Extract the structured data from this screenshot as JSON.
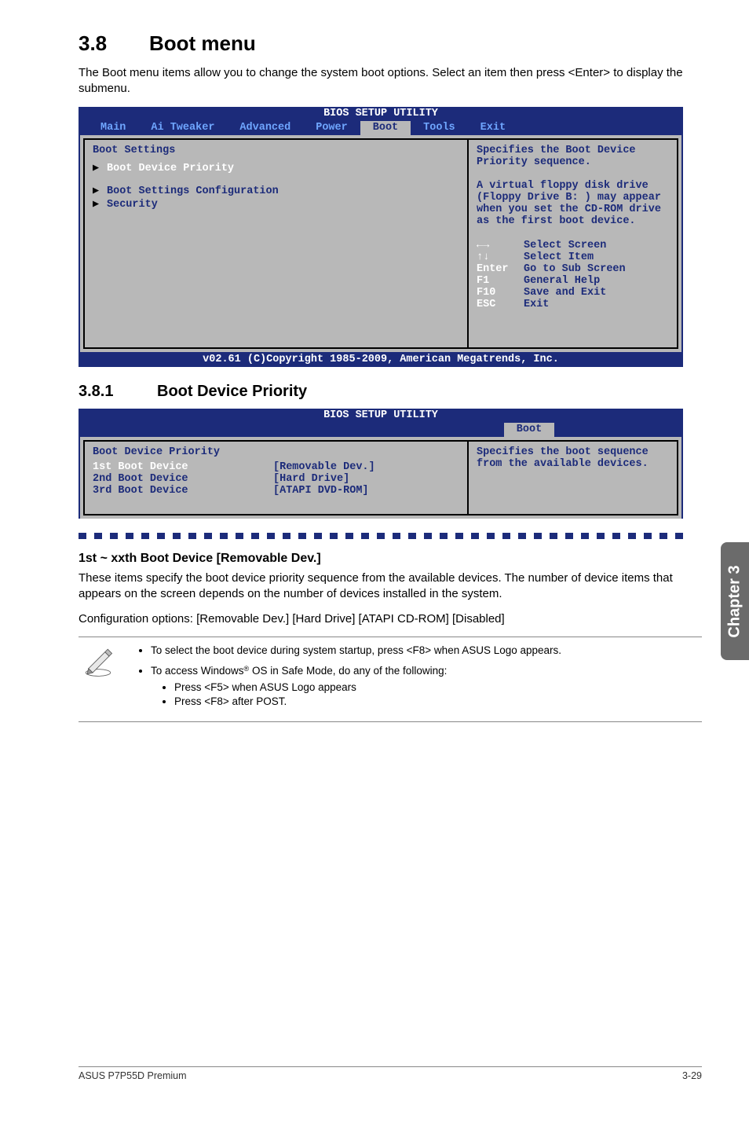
{
  "side_tab": "Chapter 3",
  "section": {
    "number": "3.8",
    "title": "Boot menu"
  },
  "intro": "The Boot menu items allow you to change the system boot options. Select an item then press <Enter> to display the submenu.",
  "bios1": {
    "top_title": "BIOS SETUP UTILITY",
    "tabs": [
      "Main",
      "Ai Tweaker",
      "Advanced",
      "Power",
      "Boot",
      "Tools",
      "Exit"
    ],
    "active_tab": "Boot",
    "heading": "Boot Settings",
    "items": [
      "Boot Device Priority",
      "Boot Settings Configuration",
      "Security"
    ],
    "hint": "Specifies the Boot Device Priority sequence.\n\nA virtual floppy disk drive (Floppy Drive B: ) may appear when you set the CD-ROM drive as the first boot device.",
    "keys": [
      {
        "k": "←→",
        "l": "Select Screen"
      },
      {
        "k": "↑↓",
        "l": "Select Item"
      },
      {
        "k": "Enter",
        "l": "Go to Sub Screen"
      },
      {
        "k": "F1",
        "l": "General Help"
      },
      {
        "k": "F10",
        "l": "Save and Exit"
      },
      {
        "k": "ESC",
        "l": "Exit"
      }
    ],
    "footer": "v02.61 (C)Copyright 1985-2009, American Megatrends, Inc."
  },
  "subsection": {
    "number": "3.8.1",
    "title": "Boot Device Priority"
  },
  "bios2": {
    "top_title": "BIOS SETUP UTILITY",
    "active_tab": "Boot",
    "heading": "Boot Device Priority",
    "rows": [
      {
        "label": "1st Boot Device",
        "val": "[Removable Dev.]"
      },
      {
        "label": "2nd Boot Device",
        "val": "[Hard Drive]"
      },
      {
        "label": "3rd Boot Device",
        "val": "[ATAPI DVD-ROM]"
      }
    ],
    "hint": "Specifies the boot sequence from the available devices."
  },
  "option_heading": "1st ~ xxth Boot Device [Removable Dev.]",
  "option_text1": "These items specify the boot device priority sequence from the available devices. The number of device items that appears on the screen depends on the number of devices installed in the system.",
  "option_text2": "Configuration options: [Removable Dev.] [Hard Drive] [ATAPI CD-ROM] [Disabled]",
  "notes": {
    "bullet1": "To select the boot device during system startup, press <F8> when ASUS Logo appears.",
    "bullet2_prefix": "To access Windows",
    "bullet2_suffix": " OS in Safe Mode, do any of the following:",
    "sub1": "Press <F5> when ASUS Logo appears",
    "sub2": "Press <F8> after POST."
  },
  "footer": {
    "left": "ASUS P7P55D Premium",
    "right": "3-29"
  }
}
